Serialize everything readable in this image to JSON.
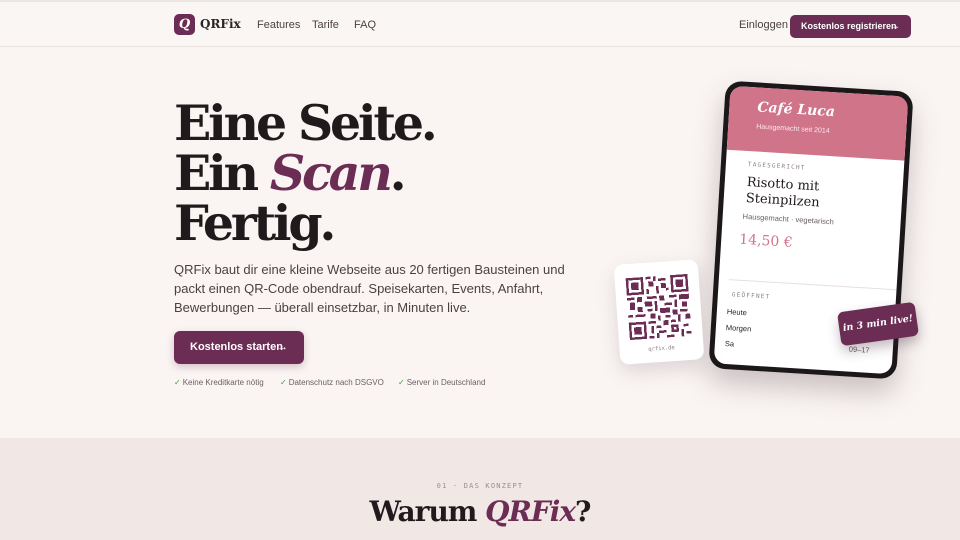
{
  "nav": {
    "logo_letter": "Q",
    "brand": "QRFix",
    "links": [
      "Features",
      "Tarife",
      "FAQ"
    ],
    "login": "Einloggen",
    "cta": "Kostenlos registrieren",
    "cta_arrow": "→"
  },
  "hero": {
    "line1": "Eine Seite.",
    "line2_a": "Ein ",
    "line2_em": "Scan",
    "line2_b": ".",
    "line3": "Fertig.",
    "lead": "QRFix baut dir eine kleine Webseite aus 20 fertigen Bausteinen und packt einen QR-Code obendrauf. Speisekarten, Events, Anfahrt, Bewerbungen — überall einsetzbar, in Minuten live.",
    "cta": "Kostenlos starten",
    "cta_arrow": "→",
    "trust": [
      "Keine Kreditkarte nötig",
      "Datenschutz nach DSGVO",
      "Server in Deutschland"
    ],
    "check": "✓"
  },
  "phone": {
    "cafe_name": "Café Luca",
    "cafe_sub": "Hausgemacht seit 2014",
    "tag_label": "TAGESGERICHT",
    "dish": "Risotto mit Steinpilzen",
    "dish_meta": "Hausgemacht · vegetarisch",
    "price": "14,50 €",
    "open_label": "GEÖFFNET",
    "hours": [
      {
        "day": "Heute",
        "time": ""
      },
      {
        "day": "Morgen",
        "time": ""
      },
      {
        "day": "Sa",
        "time": "09–17"
      }
    ]
  },
  "badge": "in 3 min live!",
  "qr": {
    "caption": "qrfix.de"
  },
  "section2": {
    "eyebrow": "01 · DAS KONZEPT",
    "title_a": "Warum ",
    "title_em": "QRFix",
    "title_b": "?"
  },
  "colors": {
    "brand": "#6c2d55",
    "accent": "#d0748a",
    "background": "#faf5f3",
    "section_bg": "#f1e7e5",
    "check": "#3f9b4f"
  }
}
